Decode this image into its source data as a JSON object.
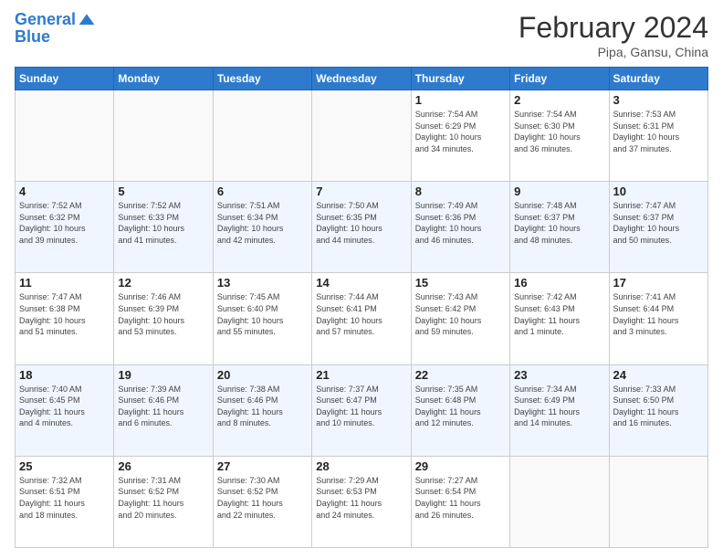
{
  "header": {
    "logo_line1": "General",
    "logo_line2": "Blue",
    "month": "February 2024",
    "location": "Pipa, Gansu, China"
  },
  "weekdays": [
    "Sunday",
    "Monday",
    "Tuesday",
    "Wednesday",
    "Thursday",
    "Friday",
    "Saturday"
  ],
  "weeks": [
    [
      {
        "day": "",
        "info": ""
      },
      {
        "day": "",
        "info": ""
      },
      {
        "day": "",
        "info": ""
      },
      {
        "day": "",
        "info": ""
      },
      {
        "day": "1",
        "info": "Sunrise: 7:54 AM\nSunset: 6:29 PM\nDaylight: 10 hours\nand 34 minutes."
      },
      {
        "day": "2",
        "info": "Sunrise: 7:54 AM\nSunset: 6:30 PM\nDaylight: 10 hours\nand 36 minutes."
      },
      {
        "day": "3",
        "info": "Sunrise: 7:53 AM\nSunset: 6:31 PM\nDaylight: 10 hours\nand 37 minutes."
      }
    ],
    [
      {
        "day": "4",
        "info": "Sunrise: 7:52 AM\nSunset: 6:32 PM\nDaylight: 10 hours\nand 39 minutes."
      },
      {
        "day": "5",
        "info": "Sunrise: 7:52 AM\nSunset: 6:33 PM\nDaylight: 10 hours\nand 41 minutes."
      },
      {
        "day": "6",
        "info": "Sunrise: 7:51 AM\nSunset: 6:34 PM\nDaylight: 10 hours\nand 42 minutes."
      },
      {
        "day": "7",
        "info": "Sunrise: 7:50 AM\nSunset: 6:35 PM\nDaylight: 10 hours\nand 44 minutes."
      },
      {
        "day": "8",
        "info": "Sunrise: 7:49 AM\nSunset: 6:36 PM\nDaylight: 10 hours\nand 46 minutes."
      },
      {
        "day": "9",
        "info": "Sunrise: 7:48 AM\nSunset: 6:37 PM\nDaylight: 10 hours\nand 48 minutes."
      },
      {
        "day": "10",
        "info": "Sunrise: 7:47 AM\nSunset: 6:37 PM\nDaylight: 10 hours\nand 50 minutes."
      }
    ],
    [
      {
        "day": "11",
        "info": "Sunrise: 7:47 AM\nSunset: 6:38 PM\nDaylight: 10 hours\nand 51 minutes."
      },
      {
        "day": "12",
        "info": "Sunrise: 7:46 AM\nSunset: 6:39 PM\nDaylight: 10 hours\nand 53 minutes."
      },
      {
        "day": "13",
        "info": "Sunrise: 7:45 AM\nSunset: 6:40 PM\nDaylight: 10 hours\nand 55 minutes."
      },
      {
        "day": "14",
        "info": "Sunrise: 7:44 AM\nSunset: 6:41 PM\nDaylight: 10 hours\nand 57 minutes."
      },
      {
        "day": "15",
        "info": "Sunrise: 7:43 AM\nSunset: 6:42 PM\nDaylight: 10 hours\nand 59 minutes."
      },
      {
        "day": "16",
        "info": "Sunrise: 7:42 AM\nSunset: 6:43 PM\nDaylight: 11 hours\nand 1 minute."
      },
      {
        "day": "17",
        "info": "Sunrise: 7:41 AM\nSunset: 6:44 PM\nDaylight: 11 hours\nand 3 minutes."
      }
    ],
    [
      {
        "day": "18",
        "info": "Sunrise: 7:40 AM\nSunset: 6:45 PM\nDaylight: 11 hours\nand 4 minutes."
      },
      {
        "day": "19",
        "info": "Sunrise: 7:39 AM\nSunset: 6:46 PM\nDaylight: 11 hours\nand 6 minutes."
      },
      {
        "day": "20",
        "info": "Sunrise: 7:38 AM\nSunset: 6:46 PM\nDaylight: 11 hours\nand 8 minutes."
      },
      {
        "day": "21",
        "info": "Sunrise: 7:37 AM\nSunset: 6:47 PM\nDaylight: 11 hours\nand 10 minutes."
      },
      {
        "day": "22",
        "info": "Sunrise: 7:35 AM\nSunset: 6:48 PM\nDaylight: 11 hours\nand 12 minutes."
      },
      {
        "day": "23",
        "info": "Sunrise: 7:34 AM\nSunset: 6:49 PM\nDaylight: 11 hours\nand 14 minutes."
      },
      {
        "day": "24",
        "info": "Sunrise: 7:33 AM\nSunset: 6:50 PM\nDaylight: 11 hours\nand 16 minutes."
      }
    ],
    [
      {
        "day": "25",
        "info": "Sunrise: 7:32 AM\nSunset: 6:51 PM\nDaylight: 11 hours\nand 18 minutes."
      },
      {
        "day": "26",
        "info": "Sunrise: 7:31 AM\nSunset: 6:52 PM\nDaylight: 11 hours\nand 20 minutes."
      },
      {
        "day": "27",
        "info": "Sunrise: 7:30 AM\nSunset: 6:52 PM\nDaylight: 11 hours\nand 22 minutes."
      },
      {
        "day": "28",
        "info": "Sunrise: 7:29 AM\nSunset: 6:53 PM\nDaylight: 11 hours\nand 24 minutes."
      },
      {
        "day": "29",
        "info": "Sunrise: 7:27 AM\nSunset: 6:54 PM\nDaylight: 11 hours\nand 26 minutes."
      },
      {
        "day": "",
        "info": ""
      },
      {
        "day": "",
        "info": ""
      }
    ]
  ]
}
